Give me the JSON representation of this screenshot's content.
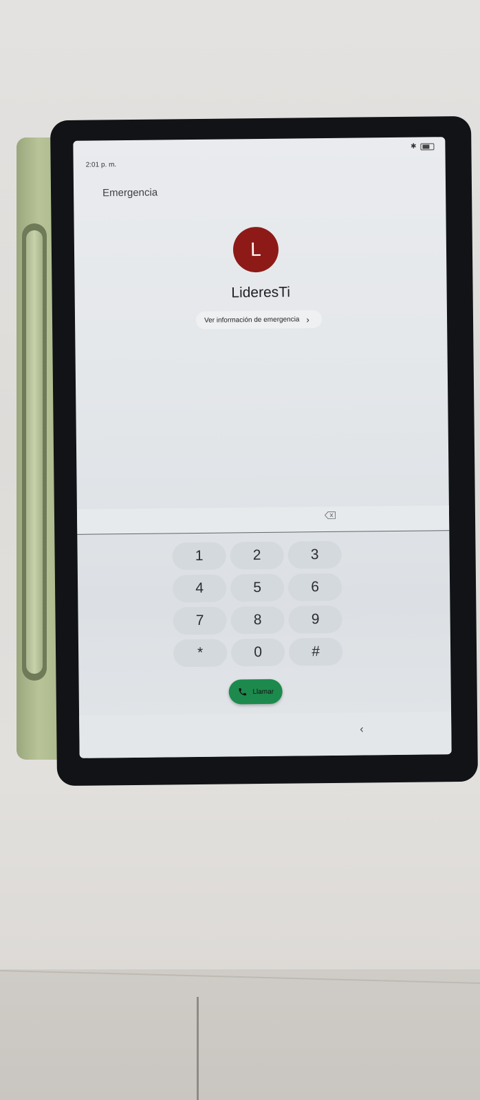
{
  "status_bar": {
    "time": "2:01 p. m.",
    "bluetooth_icon": "bluetooth-icon",
    "battery_icon": "battery-icon"
  },
  "header": {
    "title": "Emergencia"
  },
  "contact": {
    "initial": "L",
    "name": "LideresTi",
    "avatar_color": "#8e1a17"
  },
  "emergency_info": {
    "label": "Ver información de emergencia",
    "chevron_icon": "chevron-right-icon"
  },
  "dialer": {
    "number": "",
    "backspace_icon": "backspace-icon",
    "keys": [
      "1",
      "2",
      "3",
      "4",
      "5",
      "6",
      "7",
      "8",
      "9",
      "*",
      "0",
      "#"
    ],
    "call_label": "Llamar",
    "call_color": "#1c8a4c"
  },
  "nav": {
    "back_icon": "back-icon"
  }
}
